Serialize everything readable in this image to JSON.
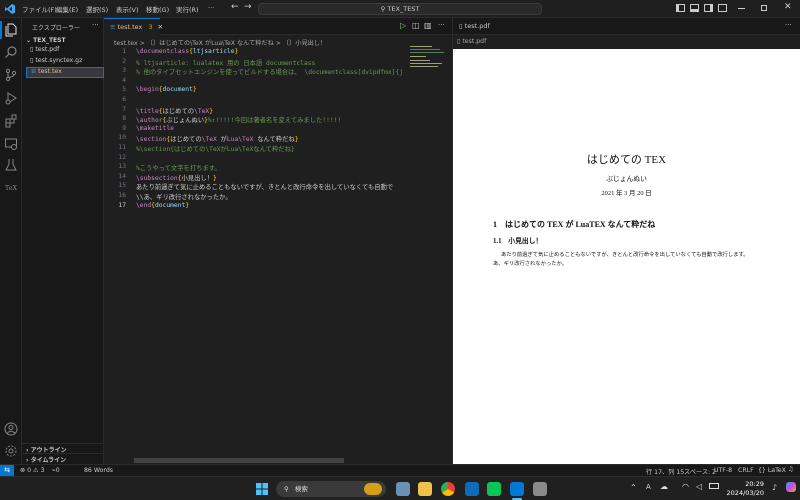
{
  "menu": {
    "file": "ファイル(F)",
    "edit": "編集(E)",
    "selection": "選択(S)",
    "view": "表示(V)",
    "go": "移動(G)",
    "run": "実行(R)"
  },
  "search_box": {
    "text": "TEX_TEST"
  },
  "sidebar": {
    "title": "エクスプローラー",
    "folder": "TEX_TEST",
    "files": [
      "test.pdf",
      "test.synctex.gz",
      "test.tex"
    ],
    "outline": "アウトライン",
    "timeline": "タイムライン"
  },
  "editor": {
    "tab_label": "test.tex",
    "tab_badge": "3",
    "breadcrumb": "test.tex > 〔〕はじめての\\TeX がLua\\TeX なんて粋だね > 〔〕小見出し！",
    "lines": [
      {
        "n": "1",
        "parts": [
          [
            "k",
            "\\documentclass"
          ],
          [
            "b",
            "{"
          ],
          [
            "d",
            "ltjsarticle"
          ],
          [
            "b",
            "}"
          ]
        ]
      },
      {
        "n": "2",
        "parts": [
          [
            "c",
            "% ltjsarticle: lualatex 用の 日本語 documentclass"
          ]
        ]
      },
      {
        "n": "3",
        "parts": [
          [
            "c",
            "% 他のタイプセットエンジンを使ってビルドする場合は、 \\documentclass[dvipdfmx]{j"
          ]
        ]
      },
      {
        "n": "4",
        "parts": []
      },
      {
        "n": "5",
        "parts": [
          [
            "k",
            "\\begin"
          ],
          [
            "b",
            "{"
          ],
          [
            "d",
            "document"
          ],
          [
            "b",
            "}"
          ]
        ]
      },
      {
        "n": "6",
        "parts": []
      },
      {
        "n": "7",
        "parts": [
          [
            "k",
            "\\title"
          ],
          [
            "b",
            "{"
          ],
          [
            "w",
            "はじめての"
          ],
          [
            "k",
            "\\TeX"
          ],
          [
            "b",
            "}"
          ]
        ]
      },
      {
        "n": "8",
        "parts": [
          [
            "k",
            "\\author"
          ],
          [
            "b",
            "{"
          ],
          [
            "w",
            "ぶじょんぬい"
          ],
          [
            "b",
            "}"
          ],
          [
            "c",
            "%↑!!!!!今回は著者名を変えてみました!!!!!"
          ]
        ]
      },
      {
        "n": "9",
        "parts": [
          [
            "k",
            "\\maketitle"
          ]
        ]
      },
      {
        "n": "10",
        "parts": [
          [
            "k",
            "\\section"
          ],
          [
            "b",
            "{"
          ],
          [
            "w",
            "はじめての"
          ],
          [
            "k",
            "\\TeX"
          ],
          [
            "w",
            " が"
          ],
          [
            "k",
            "Lua\\TeX"
          ],
          [
            "w",
            " なんて粋だね"
          ],
          [
            "b",
            "}"
          ]
        ]
      },
      {
        "n": "11",
        "parts": [
          [
            "c",
            "%\\section{はじめての\\TeXがLua\\TeXなんて粋だね}"
          ]
        ]
      },
      {
        "n": "12",
        "parts": []
      },
      {
        "n": "13",
        "parts": [
          [
            "c",
            "%こうやって文字を打ちます。"
          ]
        ]
      },
      {
        "n": "14",
        "parts": [
          [
            "k",
            "\\subsection"
          ],
          [
            "b",
            "{"
          ],
          [
            "w",
            "小見出し！"
          ],
          [
            "b",
            "}"
          ]
        ]
      },
      {
        "n": "15",
        "parts": [
          [
            "w",
            "あたり前過ぎて気に止めることもないですが、きとんと改行命令を出していなくても自動で"
          ]
        ]
      },
      {
        "n": "16",
        "parts": [
          [
            "w",
            "\\\\あ、ギリ改行されなかったか。"
          ]
        ]
      },
      {
        "n": "17",
        "parts": [
          [
            "k",
            "\\end"
          ],
          [
            "b",
            "{"
          ],
          [
            "d",
            "document"
          ],
          [
            "b",
            "}"
          ]
        ]
      }
    ]
  },
  "pdf": {
    "tab_label": "test.pdf",
    "breadcrumb": "test.pdf",
    "title": "はじめての TEX",
    "author": "ぶじょんぬい",
    "date": "2021 年 3 月 20 日",
    "section": "1　はじめての TEX が LuaTEX なんて粋だね",
    "subsection": "1.1　小見出し！",
    "body1": "あたり前過ぎて気に止めることもないですが、きとんと改行命令を出していなくても自動で改行します。",
    "body2": "あ、ギリ改行されなかったか。"
  },
  "status": {
    "problems": "⊗ 0 ⚠ 3",
    "ports": "0",
    "words": "86 Words",
    "position": "行 17、列 15",
    "spaces": "スペース: 2",
    "encoding": "UTF-8",
    "eol": "CRLF",
    "language": "LaTeX"
  },
  "taskbar": {
    "search": "検索",
    "time": "20:29",
    "date": "2024/03/20"
  },
  "colors": {
    "accent": "#0078d4",
    "active_file": "#e2c08d"
  }
}
